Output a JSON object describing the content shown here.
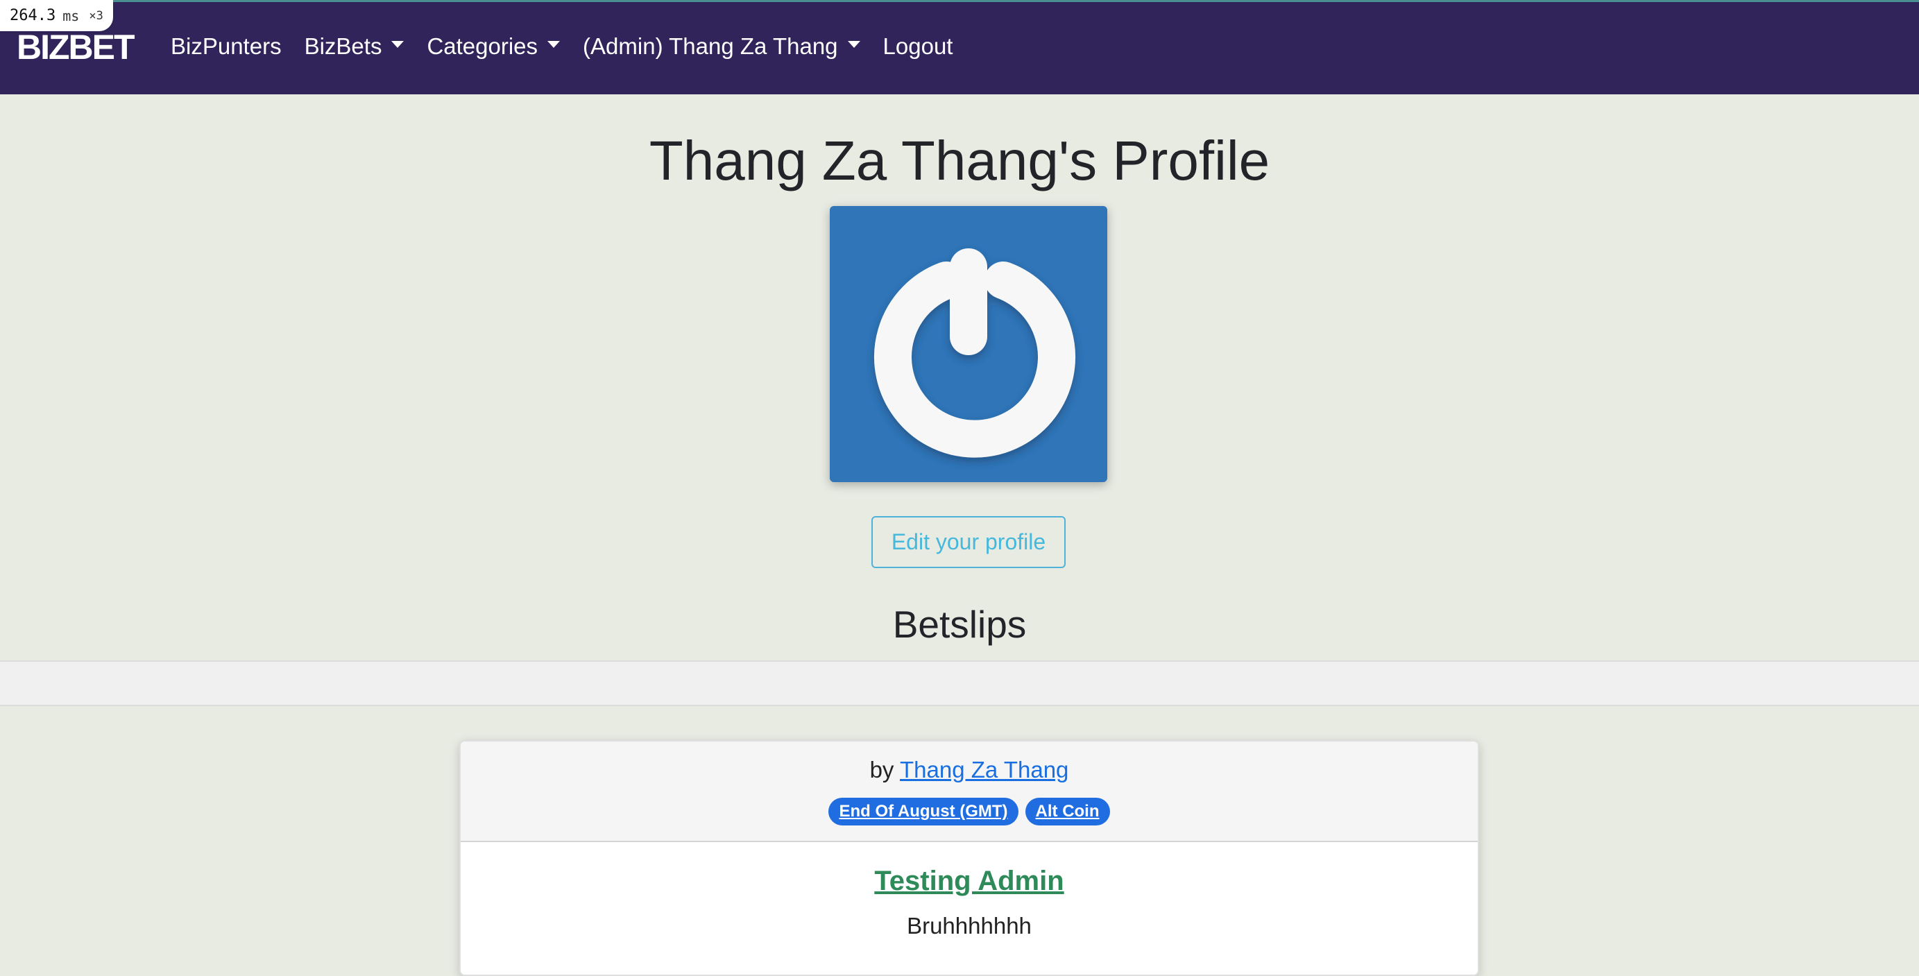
{
  "perf_overlay": {
    "value": "264.3",
    "unit": "ms",
    "multiplier": "×3"
  },
  "navbar": {
    "brand": "BIZBET",
    "items": [
      {
        "label": "BizPunters",
        "dropdown": false
      },
      {
        "label": "BizBets",
        "dropdown": true
      },
      {
        "label": "Categories",
        "dropdown": true
      },
      {
        "label": "(Admin) Thang Za Thang",
        "dropdown": true
      },
      {
        "label": "Logout",
        "dropdown": false
      }
    ]
  },
  "profile": {
    "title": "Thang Za Thang's Profile",
    "avatar_icon": "power-swirl-icon",
    "edit_label": "Edit your profile"
  },
  "betslips": {
    "heading": "Betslips",
    "card": {
      "by_prefix": "by",
      "author": "Thang Za Thang",
      "tags": [
        "End Of August (GMT)",
        "Alt Coin"
      ],
      "title": "Testing Admin",
      "text": "Bruhhhhhhh"
    }
  },
  "colors": {
    "navbar": "#30245a",
    "page_bg": "#e7ebe2",
    "avatar_bg": "#2f75b8",
    "link": "#1a6fe0",
    "badge": "#1f6de0",
    "card_title": "#2f8a5a",
    "edit_button": "#45b8dc"
  }
}
